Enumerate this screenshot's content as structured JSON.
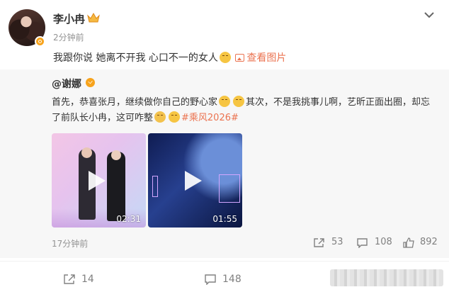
{
  "post": {
    "author": "李小冉",
    "time": "2分钟前",
    "text": "我跟你说 她离不开我 心口不一的女人",
    "view_image": "查看图片"
  },
  "repost": {
    "author": "@谢娜",
    "text_line1_a": "首先，恭喜张月，继续做你自己的野心家",
    "text_line1_b": "其次，不是我挑事儿啊，艺昕正面出圈，",
    "text_line2_a": "却忘了前队长小冉，这可咋整",
    "hashtag": "#乘风2026#",
    "videos": [
      {
        "duration": "02:31"
      },
      {
        "duration": "01:55"
      }
    ],
    "time": "17分钟前",
    "shares": "53",
    "comments": "108",
    "likes": "892"
  },
  "footer": {
    "shares": "14",
    "comments": "148"
  },
  "colors": {
    "accent": "#eb7350",
    "muted": "#939393",
    "repost_bg": "#f7f7f7",
    "badge": "#f7a31c"
  }
}
